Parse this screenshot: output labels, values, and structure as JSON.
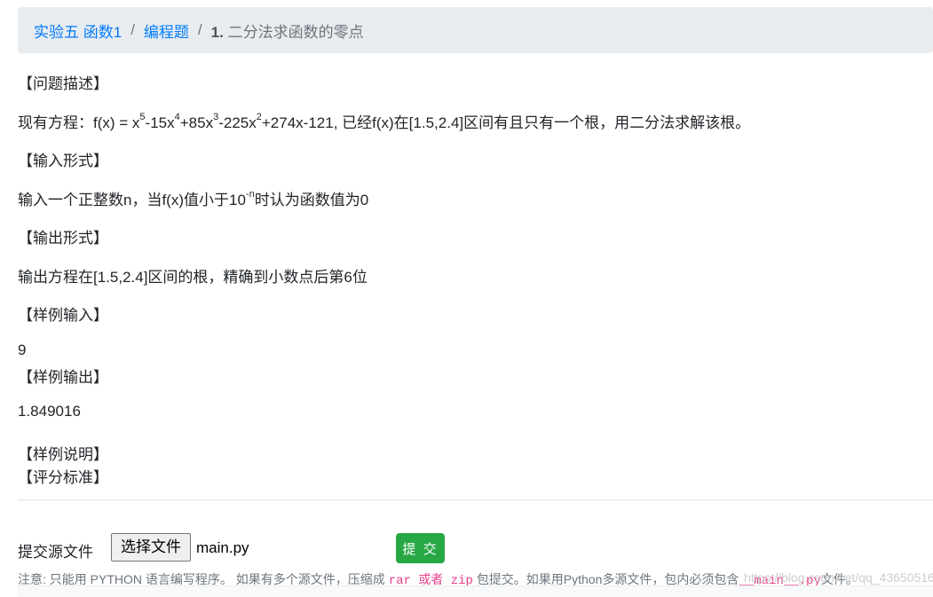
{
  "breadcrumb": {
    "item1": "实验五 函数1",
    "item2": "编程题",
    "separator": "/",
    "current_num": "1.",
    "current_title": "二分法求函数的零点"
  },
  "problem": {
    "desc_heading": "【问题描述】",
    "desc_prefix": "现有方程：f(x) = x",
    "exp5": "5",
    "t2": "-15x",
    "exp4": "4",
    "t3": "+85x",
    "exp3": "3",
    "t4": "-225x",
    "exp2": "2",
    "desc_suffix": "+274x-121, 已经f(x)在[1.5,2.4]区间有且只有一个根，用二分法求解该根。",
    "input_heading": "【输入形式】",
    "input_prefix": "输入一个正整数n，当f(x)值小于10",
    "input_exp": "-n",
    "input_suffix": "时认为函数值为0",
    "output_heading": "【输出形式】",
    "output_text": "输出方程在[1.5,2.4]区间的根，精确到小数点后第6位",
    "sample_input_heading": "【样例输入】",
    "sample_input_value": "9",
    "sample_output_heading": "【样例输出】",
    "sample_output_value": "1.849016",
    "sample_note_heading": "【样例说明】",
    "grading_heading": "【评分标准】"
  },
  "upload": {
    "label": "提交源文件",
    "choose_button": "选择文件",
    "file_name": "main.py",
    "submit_button": "提 交"
  },
  "note": {
    "part1": "注意: 只能用 PYTHON 语言编写程序。 如果有多个源文件，压缩成 ",
    "code1": "rar 或者 zip",
    "part2": " 包提交。如果用Python多源文件，包内必须包含",
    "code2": "__main__.py",
    "part3": "文件。"
  },
  "watermark": "https://blog.csdn.net/qq_43650516",
  "colors": {
    "link": "#007bff",
    "breadcrumb_bg": "#e9ecef",
    "submit_bg": "#28a745",
    "code": "#e83e8c"
  }
}
